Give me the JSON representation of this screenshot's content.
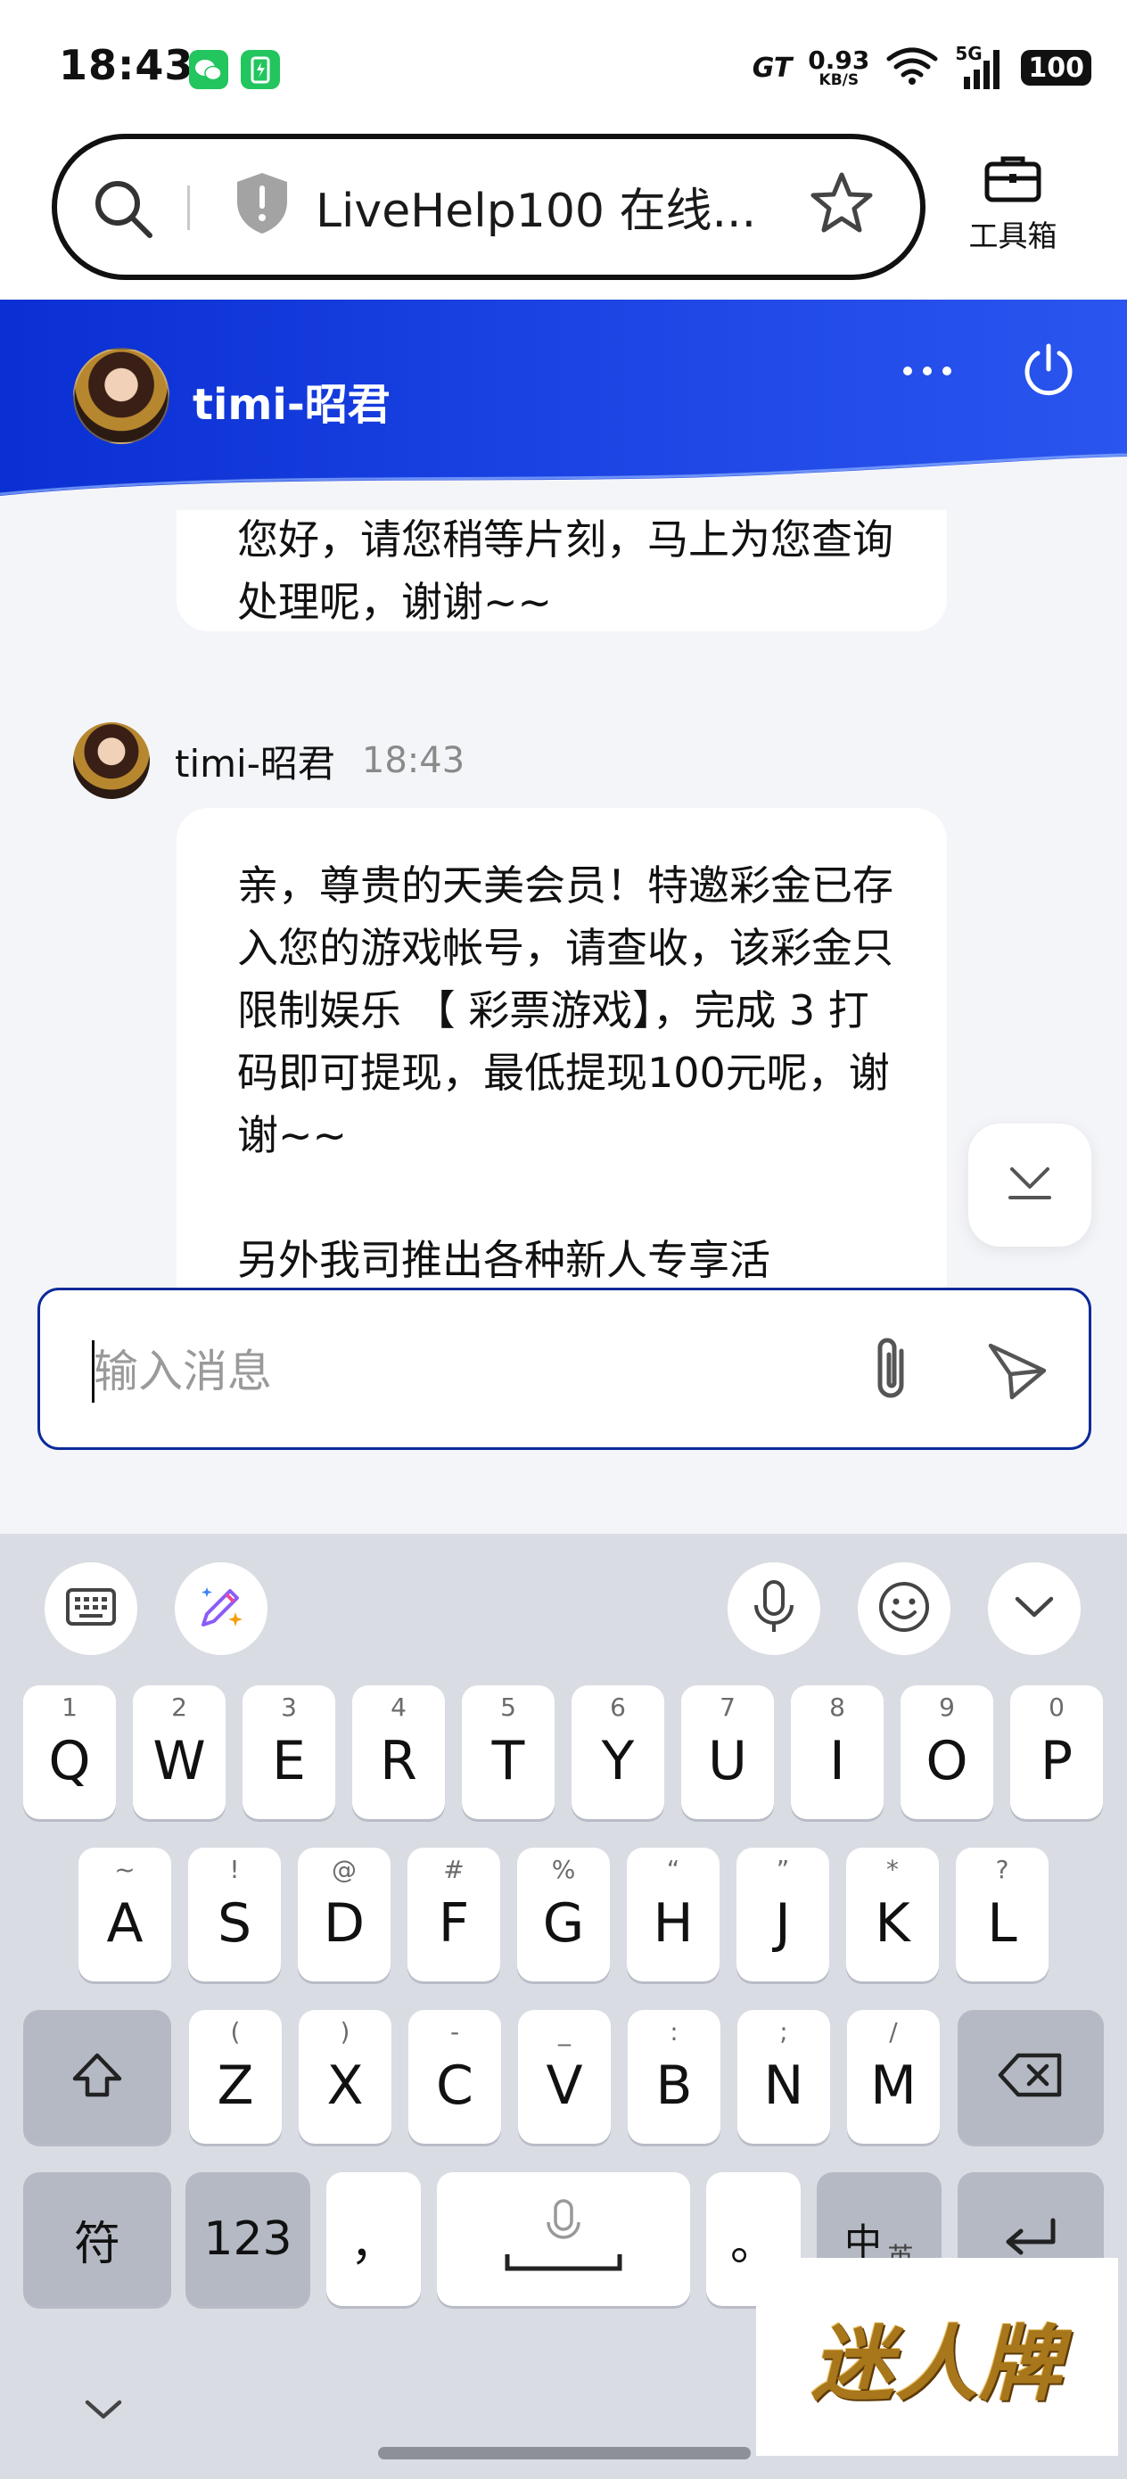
{
  "status_bar": {
    "time": "18:43",
    "network_brand": "GT",
    "net_speed_value": "0.93",
    "net_speed_unit": "KB/S",
    "signal_label": "5G",
    "battery": "100"
  },
  "browser": {
    "url_title": "LiveHelp100 在线...",
    "toolbox_label": "工具箱"
  },
  "chat": {
    "agent_name": "timi-昭君",
    "messages": [
      {
        "text": "您好，请您稍等片刻，马上为您查询处理呢，谢谢~~"
      },
      {
        "sender": "timi-昭君",
        "time": "18:43",
        "paragraph_1": "亲，尊贵的天美会员！特邀彩金已存入您的游戏帐号，请查收，该彩金只限制娱乐 【 彩票游戏】，完成 3 打码即可提现，最低提现100元呢，谢谢~~",
        "paragraph_2": "另外我司推出各种新人专享活"
      }
    ],
    "input_placeholder": "输入消息"
  },
  "keyboard": {
    "row1": [
      {
        "main": "Q",
        "sub": "1"
      },
      {
        "main": "W",
        "sub": "2"
      },
      {
        "main": "E",
        "sub": "3"
      },
      {
        "main": "R",
        "sub": "4"
      },
      {
        "main": "T",
        "sub": "5"
      },
      {
        "main": "Y",
        "sub": "6"
      },
      {
        "main": "U",
        "sub": "7"
      },
      {
        "main": "I",
        "sub": "8"
      },
      {
        "main": "O",
        "sub": "9"
      },
      {
        "main": "P",
        "sub": "0"
      }
    ],
    "row2": [
      {
        "main": "A",
        "sub": "~"
      },
      {
        "main": "S",
        "sub": "!"
      },
      {
        "main": "D",
        "sub": "@"
      },
      {
        "main": "F",
        "sub": "#"
      },
      {
        "main": "G",
        "sub": "%"
      },
      {
        "main": "H",
        "sub": "“"
      },
      {
        "main": "J",
        "sub": "”"
      },
      {
        "main": "K",
        "sub": "*"
      },
      {
        "main": "L",
        "sub": "?"
      }
    ],
    "row3": [
      {
        "main": "Z",
        "sub": "("
      },
      {
        "main": "X",
        "sub": ")"
      },
      {
        "main": "C",
        "sub": "-"
      },
      {
        "main": "V",
        "sub": "_"
      },
      {
        "main": "B",
        "sub": ":"
      },
      {
        "main": "N",
        "sub": ";"
      },
      {
        "main": "M",
        "sub": "/"
      }
    ],
    "symbol_key": "符",
    "numeric_key": "123",
    "comma_key": "，",
    "period_key": "。",
    "lang_key": "中",
    "lang_key_sub": "英"
  },
  "watermark_text": "迷人牌",
  "colors": {
    "header_blue": "#1f47e6",
    "input_border": "#0c2a9a",
    "message_bg": "#f4f5f9",
    "keyboard_bg": "#d9dce3"
  },
  "icons": [
    "search-icon",
    "shield-icon",
    "star-icon",
    "toolbox-icon",
    "more-icon",
    "power-icon",
    "scroll-down-icon",
    "attach-icon",
    "send-icon",
    "keyboard-icon",
    "ai-pen-icon",
    "mic-icon",
    "emoji-icon",
    "collapse-icon",
    "shift-icon",
    "backspace-icon",
    "enter-icon",
    "chevron-down-icon"
  ]
}
